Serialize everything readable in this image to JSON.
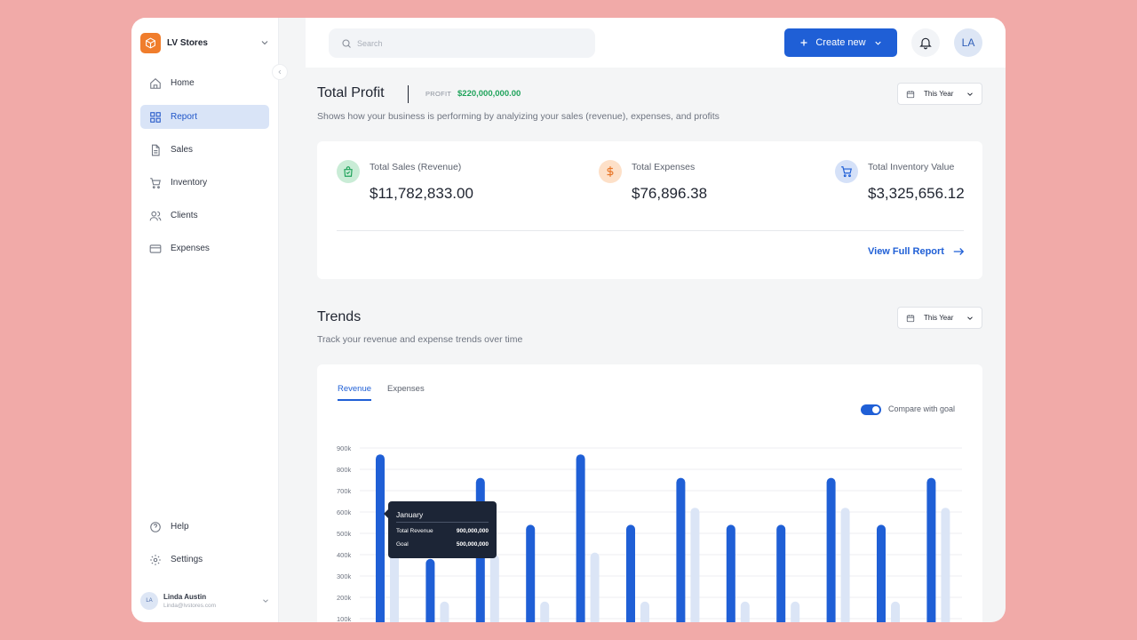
{
  "brand": {
    "name": "LV Stores"
  },
  "sidebar": {
    "items": [
      {
        "label": "Home",
        "icon": "home-icon"
      },
      {
        "label": "Report",
        "icon": "grid-icon",
        "active": true
      },
      {
        "label": "Sales",
        "icon": "document-icon"
      },
      {
        "label": "Inventory",
        "icon": "cart-icon"
      },
      {
        "label": "Clients",
        "icon": "users-icon"
      },
      {
        "label": "Expenses",
        "icon": "credit-card-icon"
      }
    ],
    "bottom_items": [
      {
        "label": "Help",
        "icon": "help-circle-icon"
      },
      {
        "label": "Settings",
        "icon": "gear-icon"
      }
    ],
    "user": {
      "initials": "LA",
      "name": "Linda Austin",
      "email": "Linda@lvstores.com"
    }
  },
  "topbar": {
    "search_placeholder": "Search",
    "create_label": "Create new",
    "avatar_initials": "LA"
  },
  "profit": {
    "title": "Total Profit",
    "label": "PROFIT",
    "value": "$220,000,000.00",
    "period": "This Year",
    "description": "Shows how your business is performing by analyizing your sales (revenue), expenses, and profits"
  },
  "kpis": [
    {
      "label": "Total Sales (Revenue)",
      "value": "$11,782,833.00",
      "icon": "shopping-bag-icon",
      "color": "#c9ecd6"
    },
    {
      "label": "Total Expenses",
      "value": "$76,896.38",
      "icon": "dollar-icon",
      "color": "#fde0c8"
    },
    {
      "label": "Total Inventory Value",
      "value": "$3,325,656.12",
      "icon": "cart-icon",
      "color": "#d5e1f8"
    }
  ],
  "view_report_label": "View Full Report",
  "trends": {
    "title": "Trends",
    "description": "Track your revenue and expense trends over time",
    "period": "This Year",
    "tabs": [
      "Revenue",
      "Expenses"
    ],
    "active_tab": "Revenue",
    "compare_label": "Compare with goal",
    "compare_enabled": true
  },
  "tooltip": {
    "title": "January",
    "rows": [
      {
        "label": "Total Revenue",
        "value": "900,000,000"
      },
      {
        "label": "Goal",
        "value": "500,000,000"
      }
    ]
  },
  "colors": {
    "accent": "#1f5fd6",
    "goal_bar": "#dbe5f6",
    "profit": "#1fa35b",
    "background": "#f1aaa8"
  },
  "chart_data": {
    "type": "bar",
    "y_tick_labels": [
      "900k",
      "800k",
      "700k",
      "600k",
      "500k",
      "400k",
      "300k",
      "200k",
      "100k"
    ],
    "ylim": [
      100,
      900
    ],
    "y_unit": "k",
    "series": [
      {
        "name": "Total Revenue",
        "values": [
          870,
          380,
          760,
          540,
          870,
          540,
          760,
          540,
          540,
          760,
          540,
          760
        ]
      },
      {
        "name": "Goal",
        "values": [
          520,
          180,
          400,
          180,
          410,
          180,
          620,
          180,
          180,
          620,
          180,
          620
        ]
      }
    ]
  }
}
